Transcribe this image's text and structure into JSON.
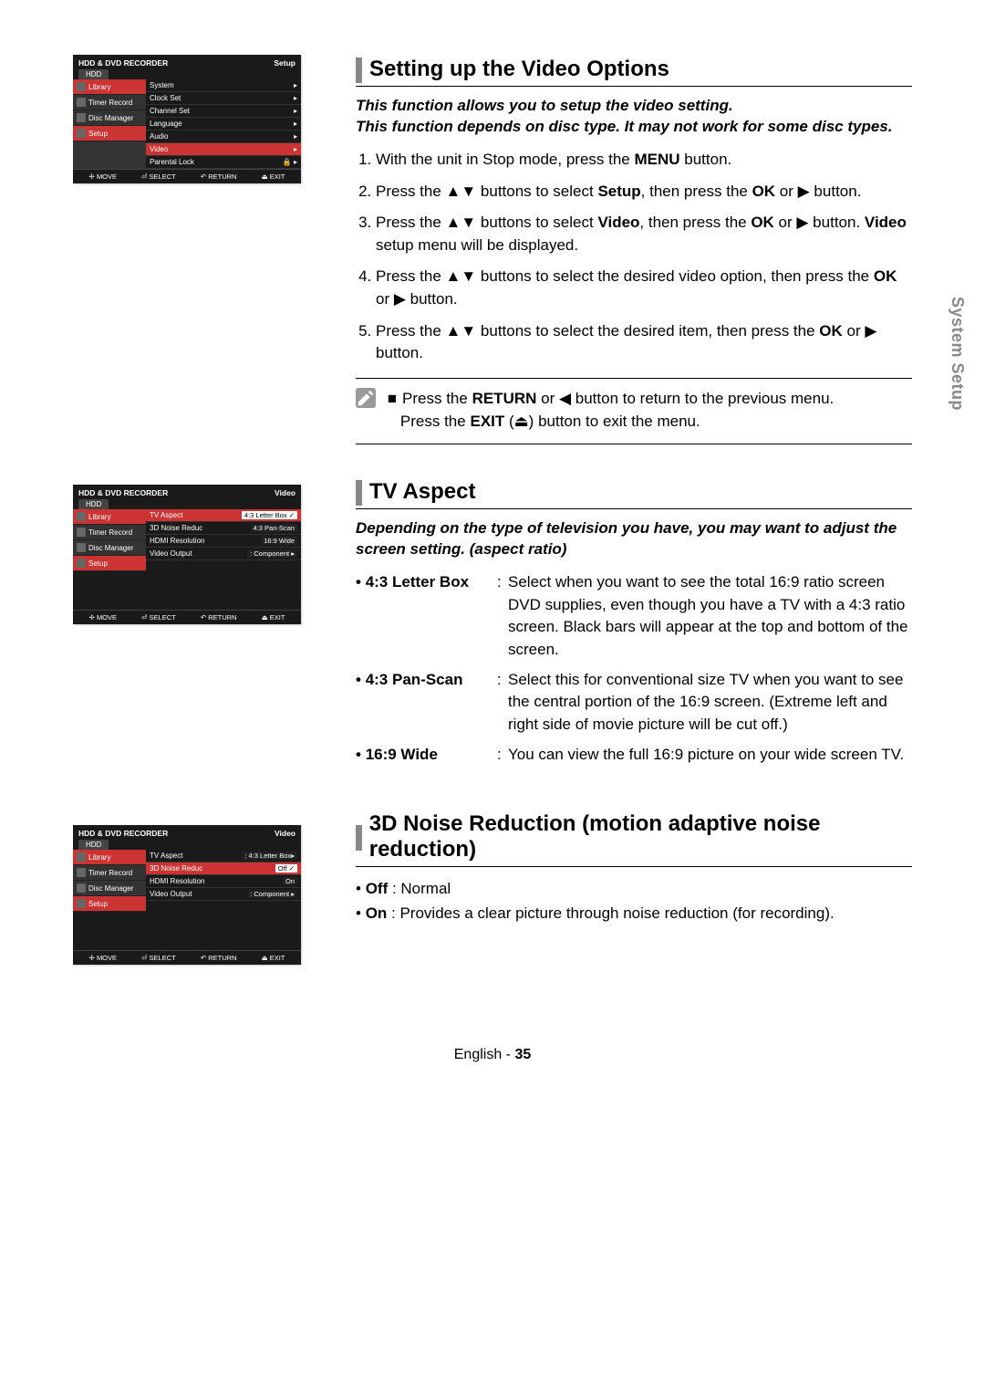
{
  "sideTab": "System Setup",
  "footer": {
    "lang": "English",
    "page": "35"
  },
  "osdCommon": {
    "title": "HDD & DVD RECORDER",
    "hdd": "HDD",
    "nav": [
      "Library",
      "Timer Record",
      "Disc Manager",
      "Setup"
    ],
    "footerBtns": [
      "MOVE",
      "SELECT",
      "RETURN",
      "EXIT"
    ],
    "footerIcons": [
      "✢",
      "⏎",
      "↶",
      "⏏"
    ]
  },
  "osd1": {
    "corner": "Setup",
    "items": [
      {
        "label": "System",
        "arrow": "▸"
      },
      {
        "label": "Clock Set",
        "arrow": "▸"
      },
      {
        "label": "Channel Set",
        "arrow": "▸"
      },
      {
        "label": "Language",
        "arrow": "▸"
      },
      {
        "label": "Audio",
        "arrow": "▸"
      },
      {
        "label": "Video",
        "arrow": "▸",
        "hl": true
      },
      {
        "label": "Parental Lock",
        "arrow": "▸",
        "lock": true
      }
    ]
  },
  "osd2": {
    "corner": "Video",
    "items": [
      {
        "label": "TV Aspect",
        "val": "4:3 Letter Box",
        "hl": true,
        "check": true
      },
      {
        "label": "3D Noise Reduc",
        "val": "4:3 Pan-Scan"
      },
      {
        "label": "HDMI Resolution",
        "val": "16:9 Wide"
      },
      {
        "label": "Video Output",
        "val": ": Component ▸"
      }
    ]
  },
  "osd3": {
    "corner": "Video",
    "items": [
      {
        "label": "TV Aspect",
        "val": ": 4:3 Letter Box▸"
      },
      {
        "label": "3D Noise Reduc",
        "val": "Off",
        "hl": true,
        "check": true
      },
      {
        "label": "HDMI Resolution",
        "val": "On"
      },
      {
        "label": "Video Output",
        "val": ": Component ▸"
      }
    ]
  },
  "sec1": {
    "heading": "Setting up the Video Options",
    "intro": "This function allows you to setup the video setting.\nThis function depends on disc type. It may not work for some disc types.",
    "steps": [
      "With the unit in Stop mode, press the MENU button.",
      "Press the ▲▼ buttons to select Setup, then press the OK or ▶ button.",
      "Press the ▲▼ buttons to select Video, then press the OK or ▶ button. Video setup menu will be displayed.",
      "Press the ▲▼ buttons to select the desired video option, then press the OK or ▶ button.",
      "Press the ▲▼ buttons to select the desired item, then press the OK or ▶ button."
    ],
    "noteLines": [
      "Press the RETURN or ◀ button to return to the previous menu.",
      "Press the EXIT (⏏) button to exit the menu."
    ]
  },
  "sec2": {
    "heading": "TV Aspect",
    "intro": "Depending on the type of television you have, you may want to adjust the screen setting. (aspect ratio)",
    "rows": [
      {
        "label": "4:3 Letter Box",
        "desc": "Select when you want to see the total 16:9 ratio screen DVD supplies, even though you have a TV with a 4:3 ratio screen. Black bars will appear at the top and bottom of the screen."
      },
      {
        "label": "4:3 Pan-Scan",
        "desc": "Select this for conventional size TV when you want to see the central portion of the 16:9 screen. (Extreme left and right side of movie picture will be cut off.)"
      },
      {
        "label": "16:9 Wide",
        "desc": "You can view the full 16:9 picture on your wide screen TV."
      }
    ]
  },
  "sec3": {
    "heading": "3D Noise Reduction (motion adaptive noise reduction)",
    "rows": [
      {
        "label": "Off",
        "desc": "Normal"
      },
      {
        "label": "On",
        "desc": "Provides a clear picture through noise reduction (for recording)."
      }
    ]
  }
}
